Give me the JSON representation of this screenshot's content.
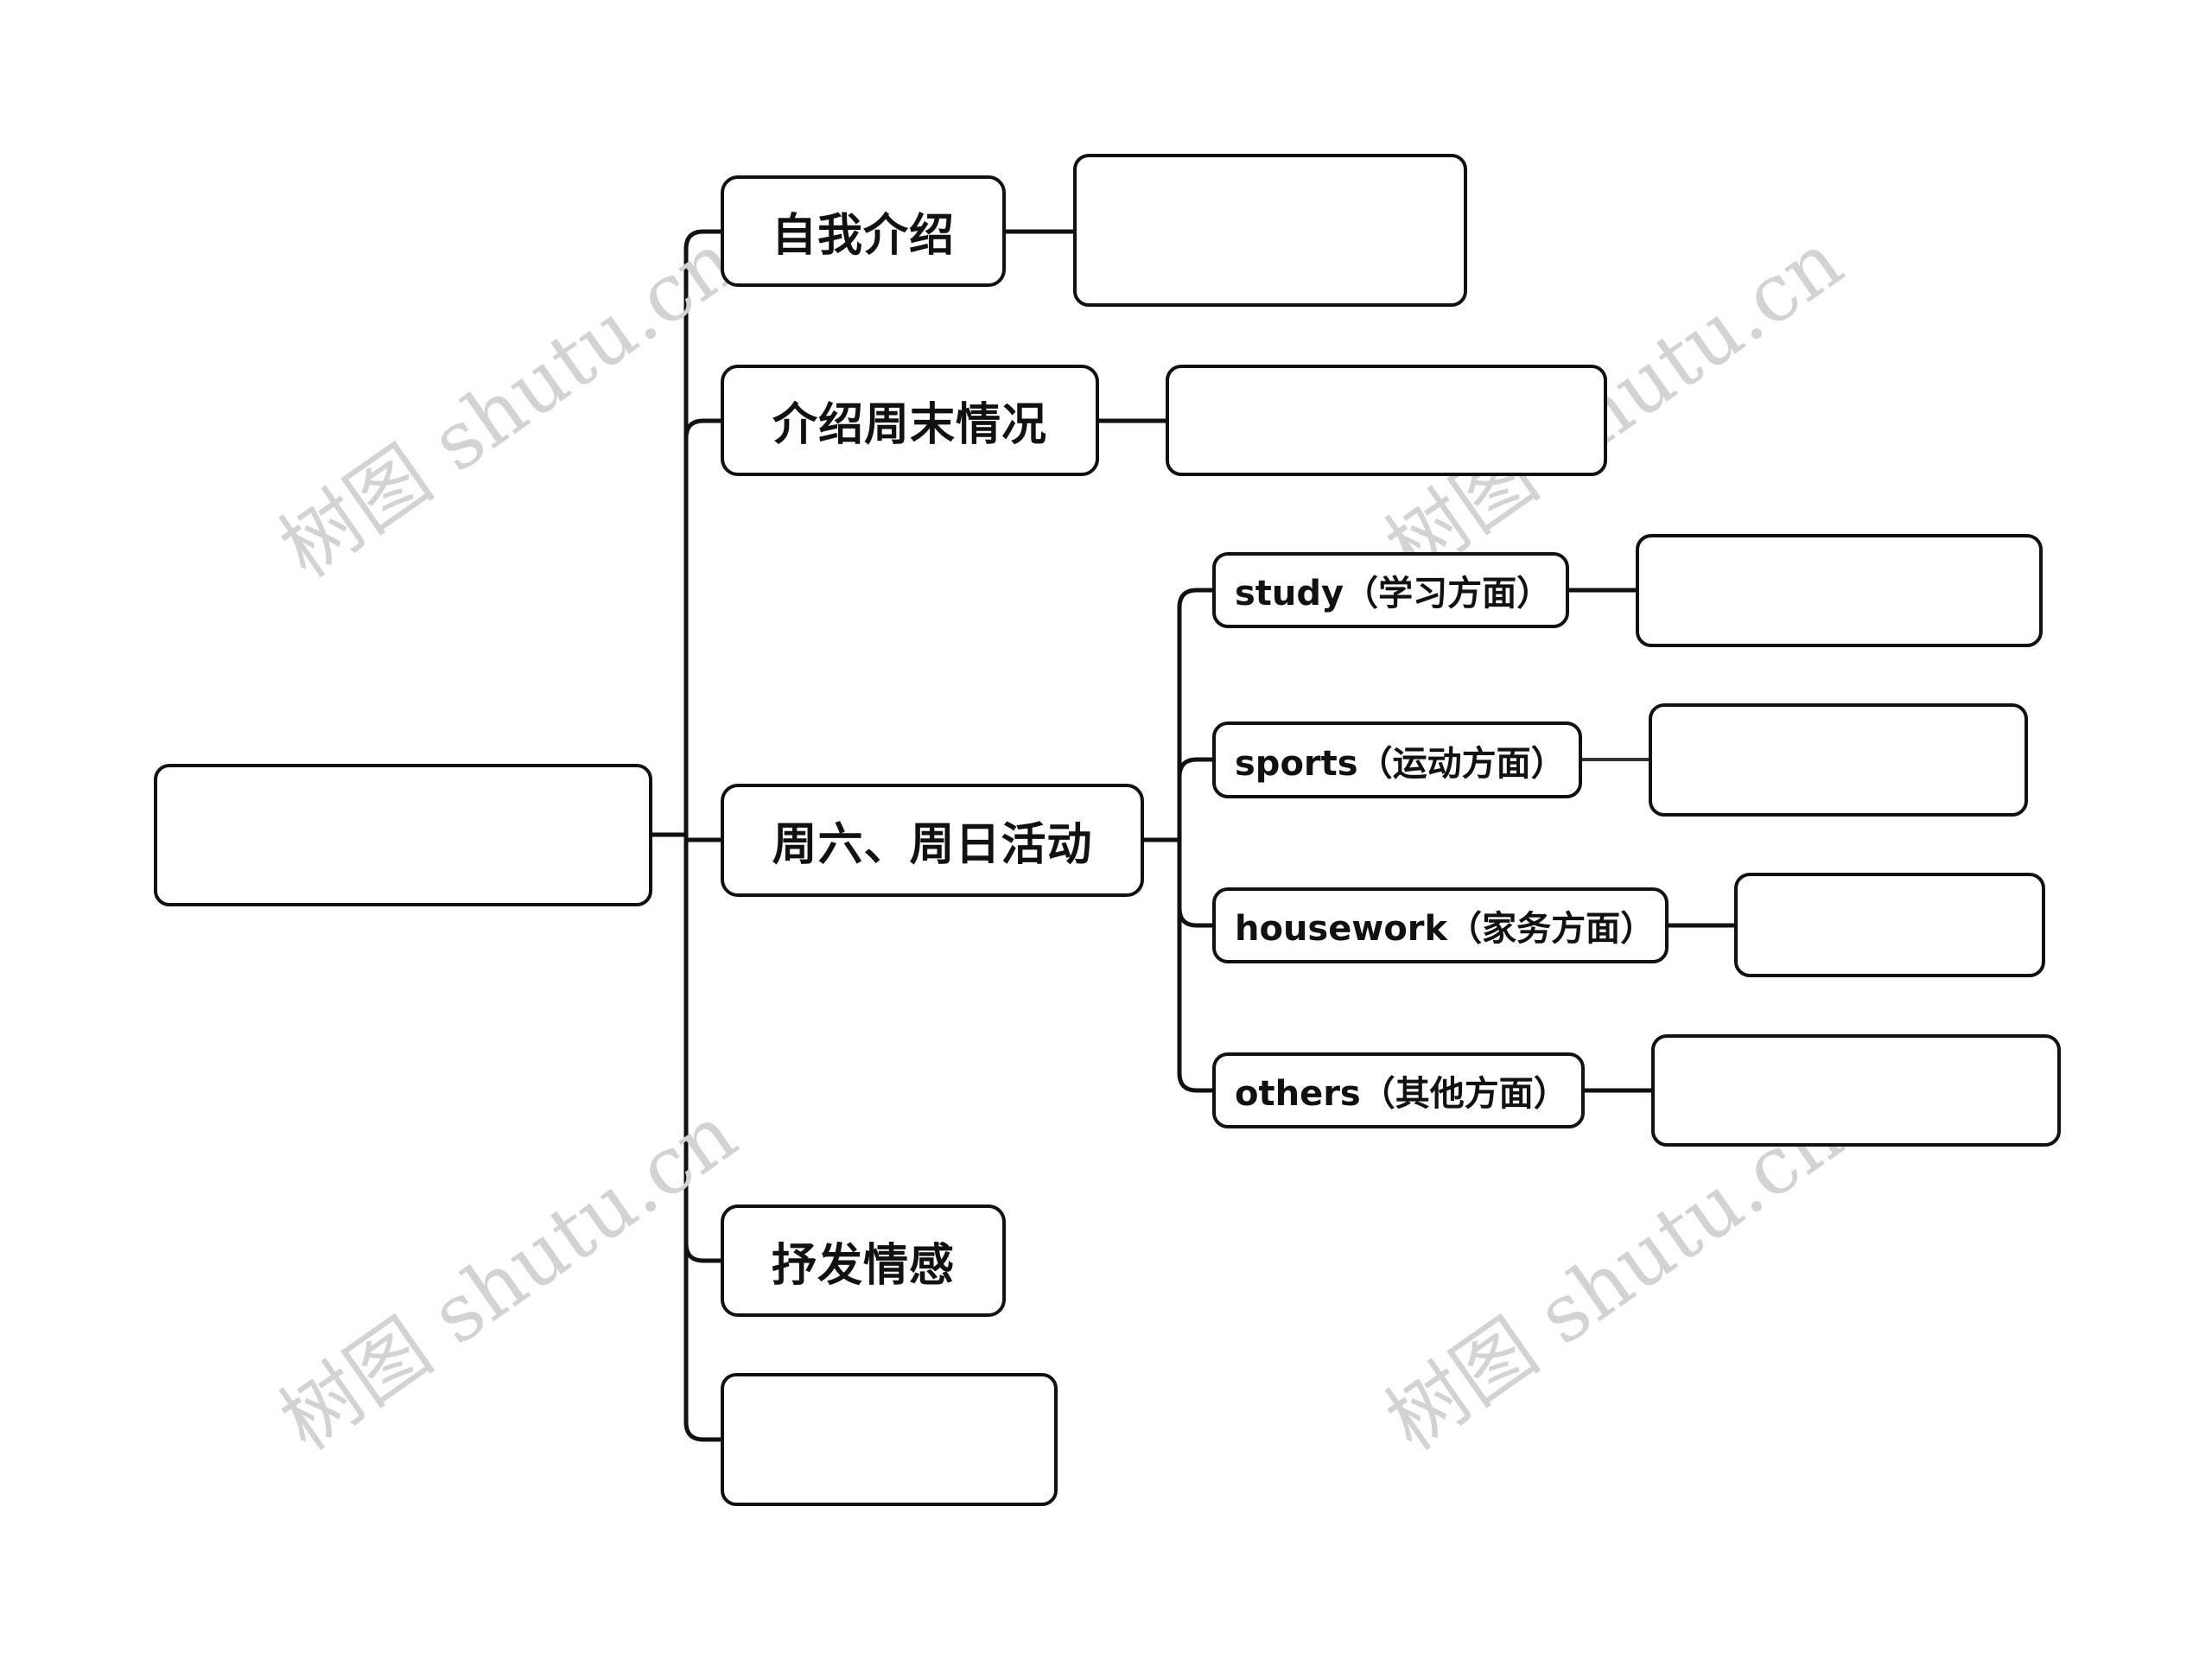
{
  "diagram": {
    "type": "mind-map",
    "root": {
      "label": ""
    },
    "branches": [
      {
        "label": "自我介绍",
        "children": [
          {
            "label": ""
          }
        ]
      },
      {
        "label": "介绍周末情况",
        "children": [
          {
            "label": ""
          }
        ]
      },
      {
        "label": "周六、周日活动",
        "children": [
          {
            "label": "study（学习方面）",
            "children": [
              {
                "label": ""
              }
            ]
          },
          {
            "label": "sports（运动方面）",
            "children": [
              {
                "label": ""
              }
            ]
          },
          {
            "label": "housework（家务方面）",
            "children": [
              {
                "label": ""
              }
            ]
          },
          {
            "label": "others（其他方面）",
            "children": [
              {
                "label": ""
              }
            ]
          }
        ]
      },
      {
        "label": "抒发情感",
        "children": []
      },
      {
        "label": "",
        "children": []
      }
    ]
  },
  "watermark": {
    "text": "树图 shutu.cn",
    "color": "#d3d3d3"
  },
  "colors": {
    "line": "#111111",
    "node_border": "#111111",
    "node_fill": "#ffffff",
    "text": "#111111"
  }
}
